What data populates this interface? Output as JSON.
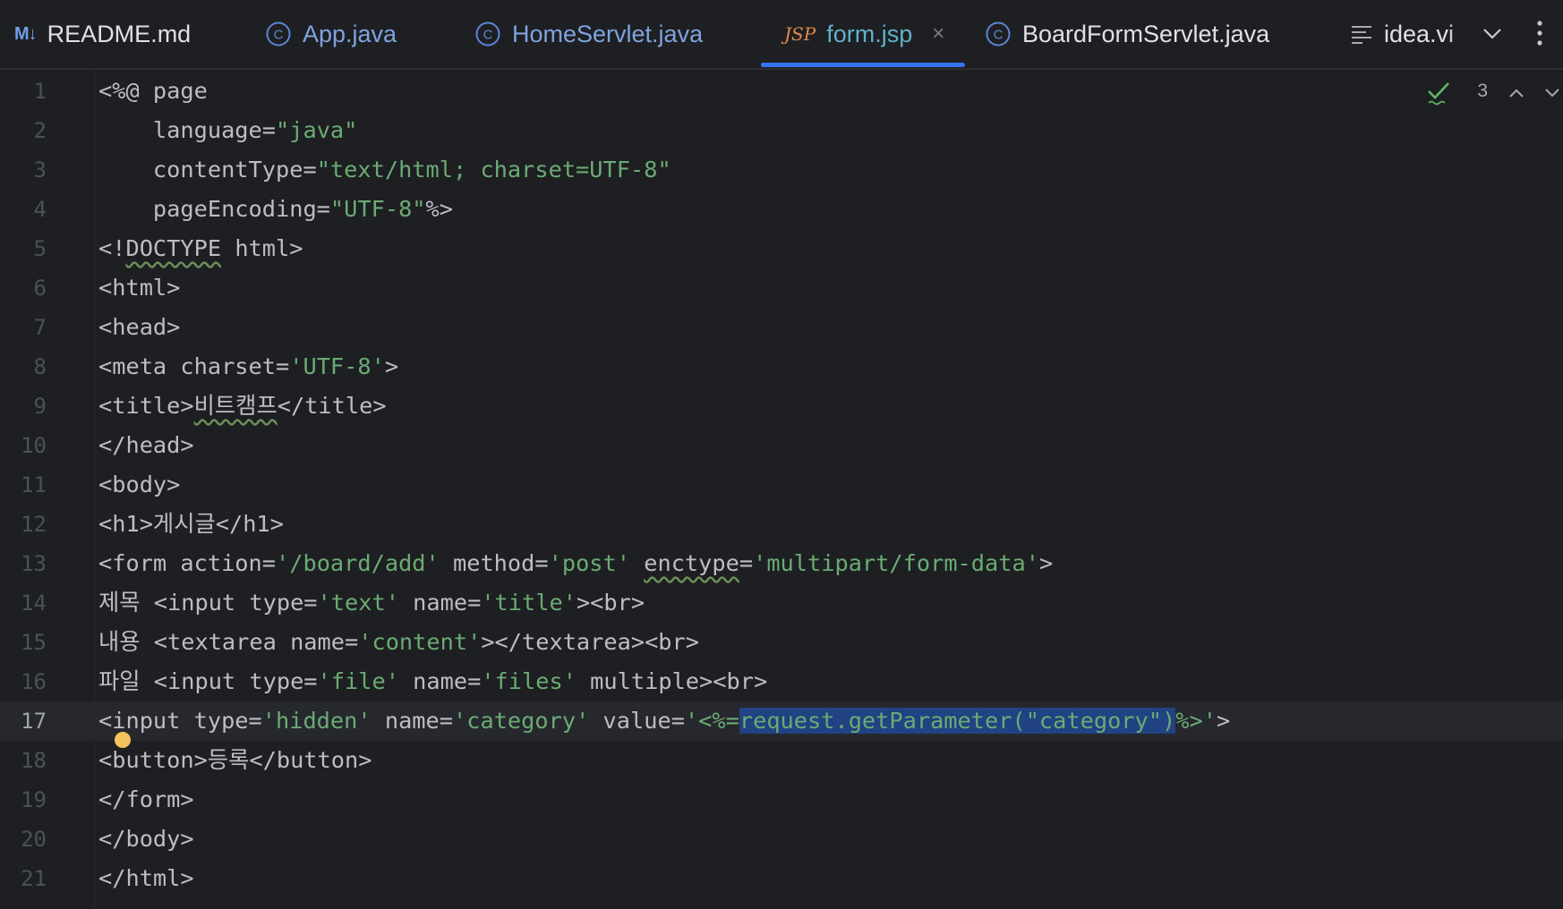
{
  "tabs": [
    {
      "icon": "markdown-icon",
      "icon_text": "M↓",
      "label": "README.md",
      "active": false
    },
    {
      "icon": "java-class-icon",
      "label": "App.java",
      "active": false
    },
    {
      "icon": "java-class-icon",
      "label": "HomeServlet.java",
      "active": false
    },
    {
      "icon": "jsp-file-icon",
      "icon_text": "JSP",
      "label": "form.jsp",
      "active": true,
      "close": "×"
    },
    {
      "icon": "java-class-icon",
      "label": "BoardFormServlet.java",
      "active": false
    },
    {
      "icon": "text-lines-icon",
      "label": "idea.vi",
      "active": false
    }
  ],
  "inspections": {
    "count": "3"
  },
  "editor": {
    "current_line": 17,
    "line_numbers": [
      "1",
      "2",
      "3",
      "4",
      "5",
      "6",
      "7",
      "8",
      "9",
      "10",
      "11",
      "12",
      "13",
      "14",
      "15",
      "16",
      "17",
      "18",
      "19",
      "20",
      "21"
    ]
  },
  "colors": {
    "background": "#1e1f22",
    "string": "#6aab73",
    "selection": "#214283",
    "accent": "#3574f0"
  }
}
